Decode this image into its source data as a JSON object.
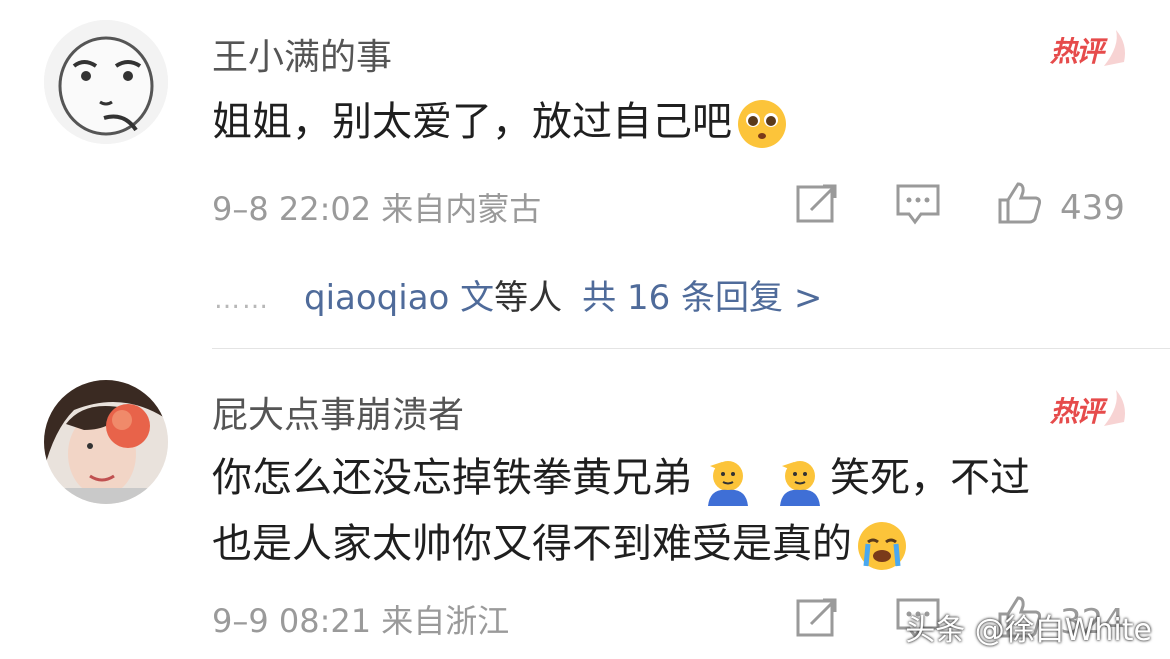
{
  "comments": [
    {
      "username": "王小满的事",
      "badge": "热评",
      "text_before_emoji": "姐姐，别太爱了，放过自己吧",
      "emoji": "pleading-face-emoji",
      "meta": "9–8 22:02 来自内蒙古",
      "like_count": "439",
      "replies": {
        "dots": "……",
        "names": "qiaoqiao 文",
        "suffix": "等人",
        "count": "共 16 条回复 >"
      }
    },
    {
      "username": "屁大点事崩溃者",
      "badge": "热评",
      "line1_text": "你怎么还没忘掉铁拳黄兄弟",
      "line1_after": "笑死，不过",
      "line2_text": "也是人家太帅你又得不到难受是真的",
      "emojis": [
        "saluting-face-emoji",
        "saluting-face-emoji",
        "crying-face-emoji"
      ],
      "meta": "9–9 08:21 来自浙江",
      "like_count": "324"
    }
  ],
  "watermark": "头条 @徐白White",
  "icons": [
    "share-icon",
    "comment-icon",
    "like-icon"
  ],
  "colors": {
    "badge": "#e64b4b",
    "link": "#4f6b9a",
    "meta": "#9a9a9a"
  }
}
